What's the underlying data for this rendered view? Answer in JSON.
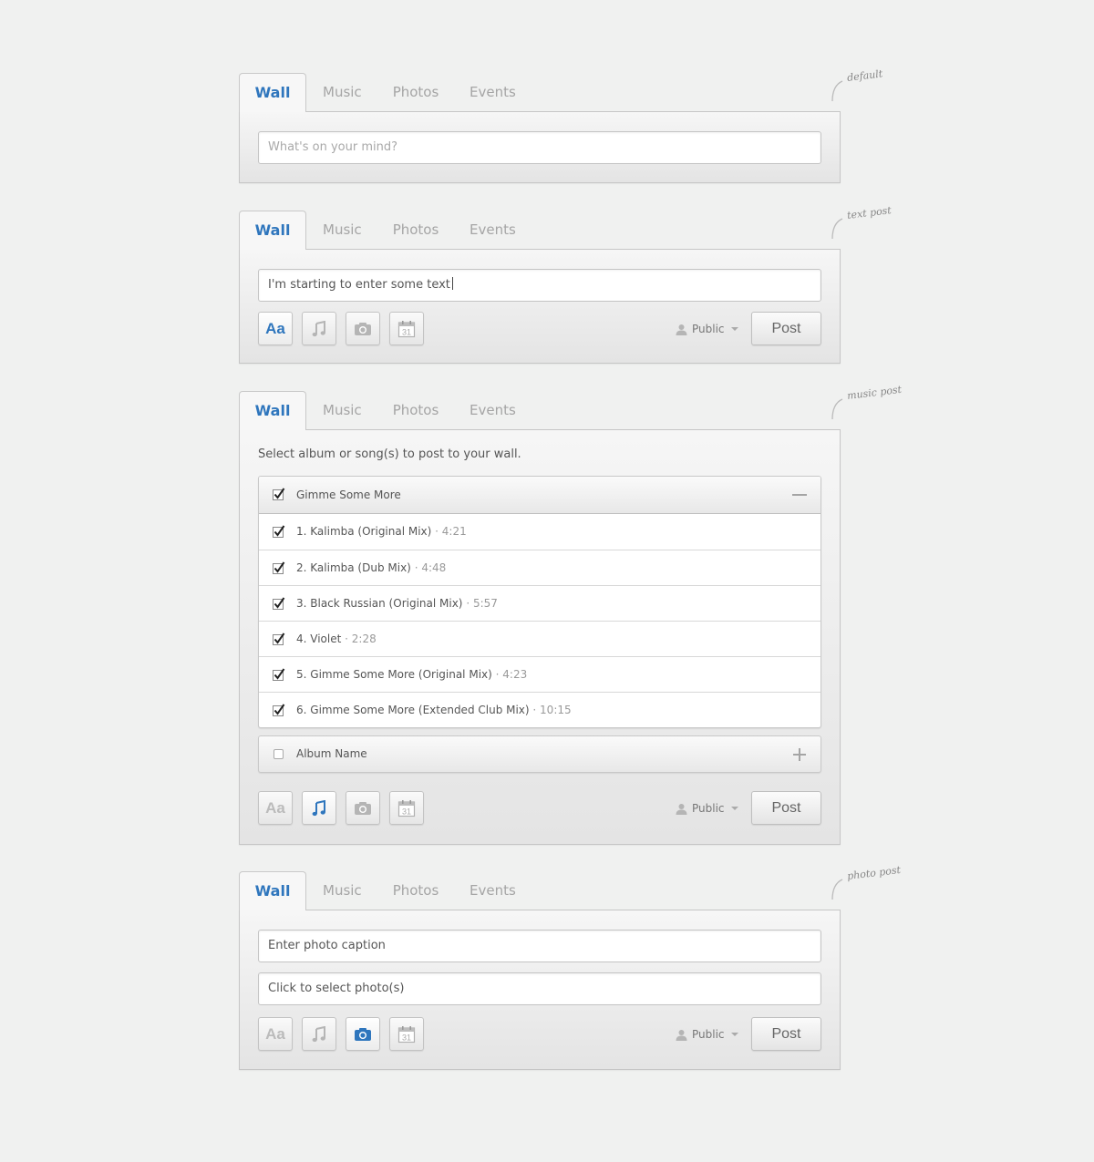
{
  "tabs": [
    "Wall",
    "Music",
    "Photos",
    "Events"
  ],
  "annotations": {
    "default": "default",
    "text_post": "text post",
    "music_post": "music post",
    "photo_post": "photo post"
  },
  "default_widget": {
    "status_placeholder": "What's on your mind?"
  },
  "text_widget": {
    "status_value": "I'm starting to enter some text"
  },
  "music_widget": {
    "instructions": "Select album or song(s) to post to your wall.",
    "album": {
      "name": "Gimme Some More",
      "checked": true,
      "expanded": true,
      "songs": [
        {
          "title": "1. Kalimba (Original Mix)",
          "duration": "· 4:21",
          "checked": true
        },
        {
          "title": "2. Kalimba (Dub Mix)",
          "duration": "· 4:48",
          "checked": true
        },
        {
          "title": "3. Black Russian (Original Mix)",
          "duration": "· 5:57",
          "checked": true
        },
        {
          "title": "4. Violet",
          "duration": "· 2:28",
          "checked": true
        },
        {
          "title": "5. Gimme Some More (Original Mix)",
          "duration": "· 4:23",
          "checked": true
        },
        {
          "title": "6. Gimme Some More (Extended Club Mix)",
          "duration": "· 10:15",
          "checked": true
        }
      ]
    },
    "album2": {
      "name": "Album Name",
      "checked": false,
      "expanded": false
    }
  },
  "photo_widget": {
    "caption_placeholder": "Enter photo caption",
    "select_placeholder": "Click to select photo(s)"
  },
  "toolbar": {
    "text_tool_label": "Aa",
    "privacy_label": "Public",
    "post_label": "Post",
    "calendar_day": "31",
    "icons": [
      "text-format-icon",
      "music-note-icon",
      "camera-icon",
      "calendar-icon",
      "person-icon"
    ]
  },
  "colors": {
    "accent": "#2f76bd",
    "inactive_icon": "#b5b5b5",
    "background": "#f0f1f0",
    "panel_border": "#c6c6c6"
  }
}
